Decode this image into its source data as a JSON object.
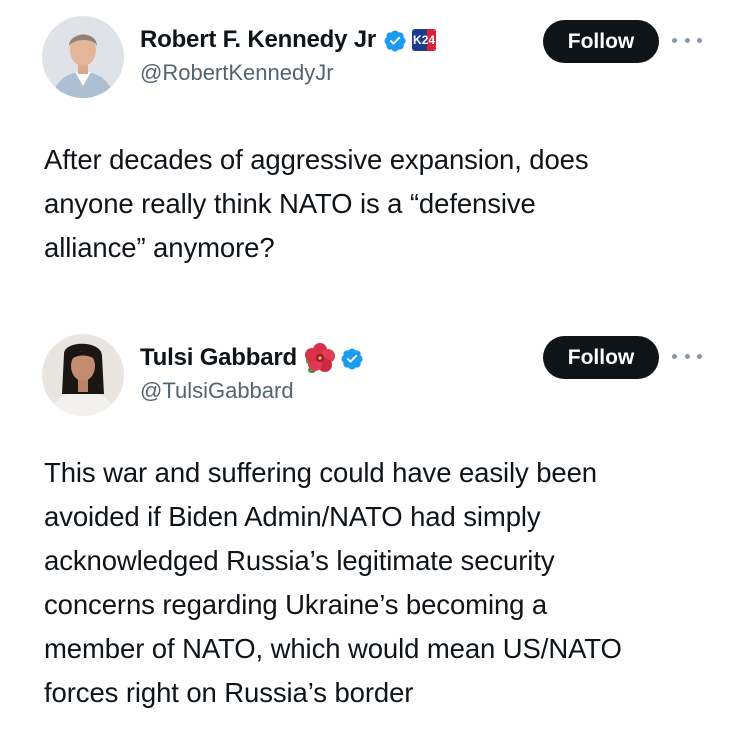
{
  "tweets": [
    {
      "display_name": "Robert F. Kennedy Jr",
      "handle": "@RobertKennedyJr",
      "follow_label": "Follow",
      "badge_text": "K24",
      "text_lines": [
        "After decades of aggressive expansion, does",
        "anyone really think NATO is a “defensive",
        "alliance” anymore?"
      ]
    },
    {
      "display_name": "Tulsi Gabbard",
      "handle": "@TulsiGabbard",
      "follow_label": "Follow",
      "name_emoji": "hibiscus-flower",
      "text_lines": [
        "This war and suffering could have easily been",
        "avoided if Biden Admin/NATO had simply",
        "acknowledged Russia’s legitimate security",
        "concerns regarding Ukraine’s becoming a",
        "member of NATO, which would mean US/NATO",
        "forces right on Russia’s border"
      ]
    }
  ],
  "colors": {
    "text": "#0f1419",
    "secondary_text": "#536471",
    "verified_blue": "#1d9bf0",
    "follow_button_bg": "#0f1419",
    "follow_button_text": "#ffffff"
  },
  "icons": [
    "verified-badge-icon",
    "k24-badge-icon",
    "hibiscus-flower-icon",
    "more-options-icon"
  ]
}
